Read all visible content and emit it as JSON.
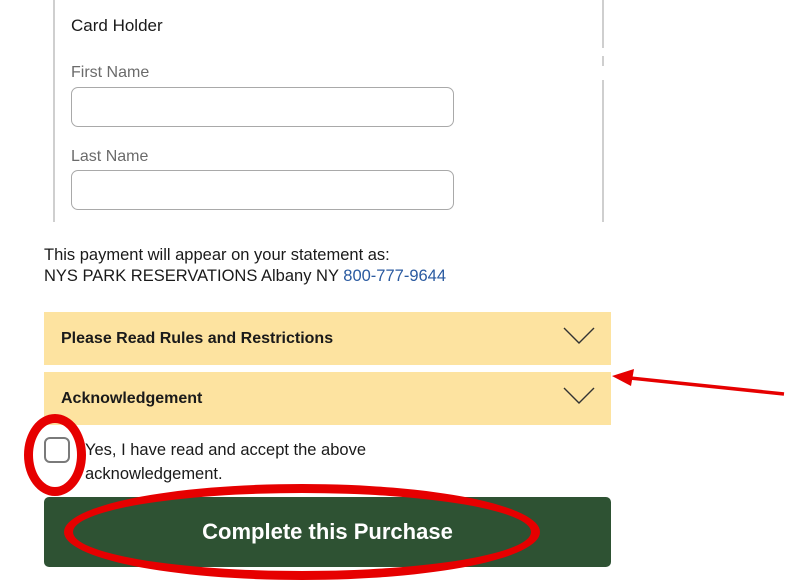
{
  "card_holder": {
    "title": "Card Holder",
    "first_name_label": "First Name",
    "first_name_value": "",
    "last_name_label": "Last Name",
    "last_name_value": ""
  },
  "statement": {
    "line1": "This payment will appear on your statement as:",
    "line2": "NYS PARK RESERVATIONS Albany NY",
    "phone": "800-777-9644"
  },
  "accordions": {
    "rules_label": "Please Read Rules and Restrictions",
    "ack_label": "Acknowledgement"
  },
  "acknowledge": {
    "checkbox_label": "Yes, I have read and accept the above acknowledgement.",
    "checked": false
  },
  "purchase": {
    "button_label": "Complete this Purchase"
  },
  "colors": {
    "accordion_bg": "#fde3a0",
    "button_bg": "#2e5233",
    "annotation_red": "#e60000",
    "link_blue": "#2a5aa0"
  }
}
